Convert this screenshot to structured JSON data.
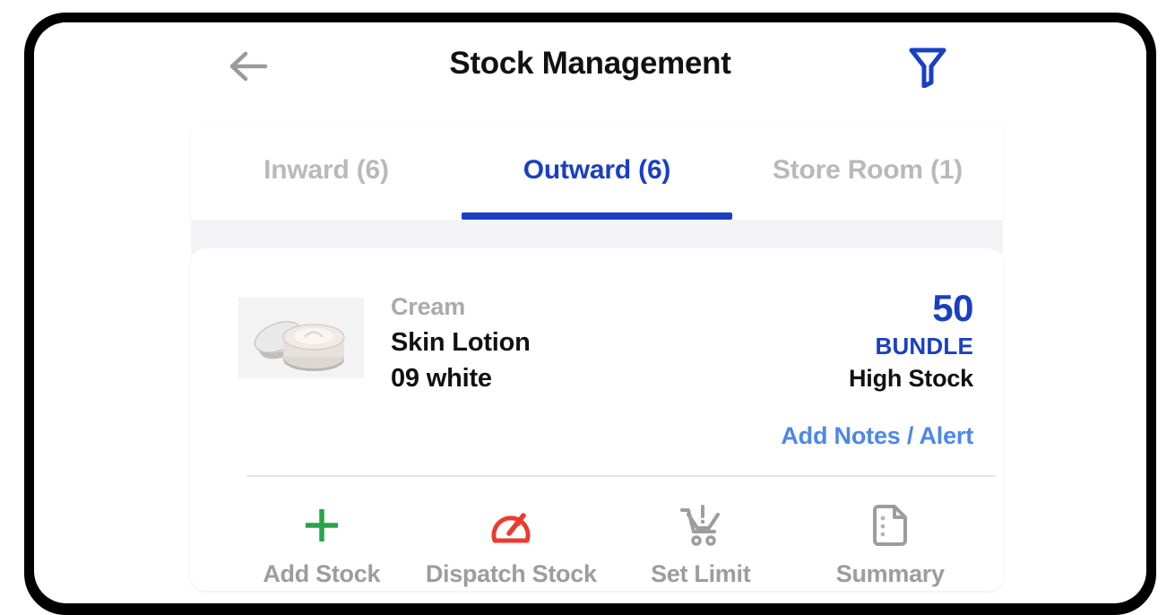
{
  "header": {
    "title": "Stock Management",
    "back_icon": "arrow-left-icon",
    "filter_icon": "filter-funnel-icon",
    "filter_color": "#1a3fc4"
  },
  "tabs": {
    "active_index": 1,
    "active_color": "#1a3fc4",
    "inactive_color": "#b9b9bd",
    "items": [
      {
        "label": "Inward (6)"
      },
      {
        "label": "Outward (6)"
      },
      {
        "label": "Store Room (1)"
      }
    ]
  },
  "product": {
    "thumbnail_icon": "cream-jar-image",
    "category": "Cream",
    "name": "Skin Lotion",
    "variant": "09 white",
    "stock_quantity": "50",
    "stock_unit": "BUNDLE",
    "stock_status": "High Stock",
    "stock_color": "#1a3fc4",
    "notes_link": "Add Notes / Alert",
    "notes_link_color": "#4d87e8"
  },
  "actions": [
    {
      "label": "Add Stock",
      "icon": "plus-icon",
      "color": "#2aa34a"
    },
    {
      "label": "Dispatch Stock",
      "icon": "speedometer-icon",
      "color": "#eb3b2e"
    },
    {
      "label": "Set Limit",
      "icon": "cart-alert-icon",
      "color": "#9c9ca1"
    },
    {
      "label": "Summary",
      "icon": "document-list-icon",
      "color": "#9c9ca1"
    }
  ]
}
